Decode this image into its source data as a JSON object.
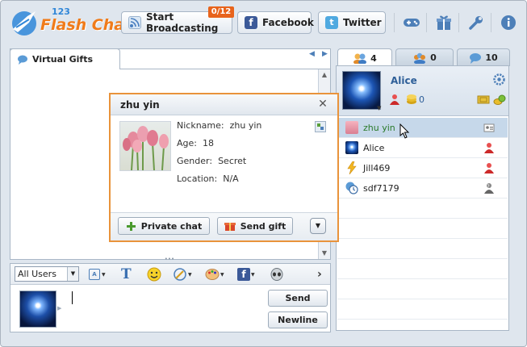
{
  "header": {
    "logo_number": "123",
    "logo_text": "Flash Chat",
    "broadcast_label": "Start Broadcasting",
    "broadcast_badge": "0/12",
    "facebook_label": "Facebook",
    "twitter_label": "Twitter",
    "tools": [
      "gamepad-icon",
      "gift-icon",
      "wrench-icon",
      "info-icon"
    ]
  },
  "left_tab": {
    "label": "Virtual Gifts"
  },
  "right_tabs": [
    {
      "count": "4",
      "icon": "users-icon"
    },
    {
      "count": "0",
      "icon": "group-icon"
    },
    {
      "count": "10",
      "icon": "chat-bubble-icon"
    }
  ],
  "current_user": {
    "name": "Alice",
    "coins": "0"
  },
  "user_list": [
    {
      "name": "zhu yin",
      "selected": true
    },
    {
      "name": "Alice",
      "selected": false
    },
    {
      "name": "Jill469",
      "selected": false
    },
    {
      "name": "sdf7179",
      "selected": false
    }
  ],
  "popup": {
    "title": "zhu yin",
    "nickname_label": "Nickname:",
    "nickname": "zhu yin",
    "age_label": "Age:",
    "age": "18",
    "gender_label": "Gender:",
    "gender": "Secret",
    "location_label": "Location:",
    "location": "N/A",
    "private_chat_label": "Private chat",
    "send_gift_label": "Send gift",
    "close_glyph": "✕"
  },
  "input": {
    "recipient": "All Users",
    "send_label": "Send",
    "newline_label": "Newline"
  },
  "colors": {
    "accent_orange": "#e9933b",
    "selected_row": "#c6d8ea",
    "selected_text": "#2a7a2a",
    "logo_blue": "#2f86d8",
    "logo_orange": "#f07b1a"
  }
}
